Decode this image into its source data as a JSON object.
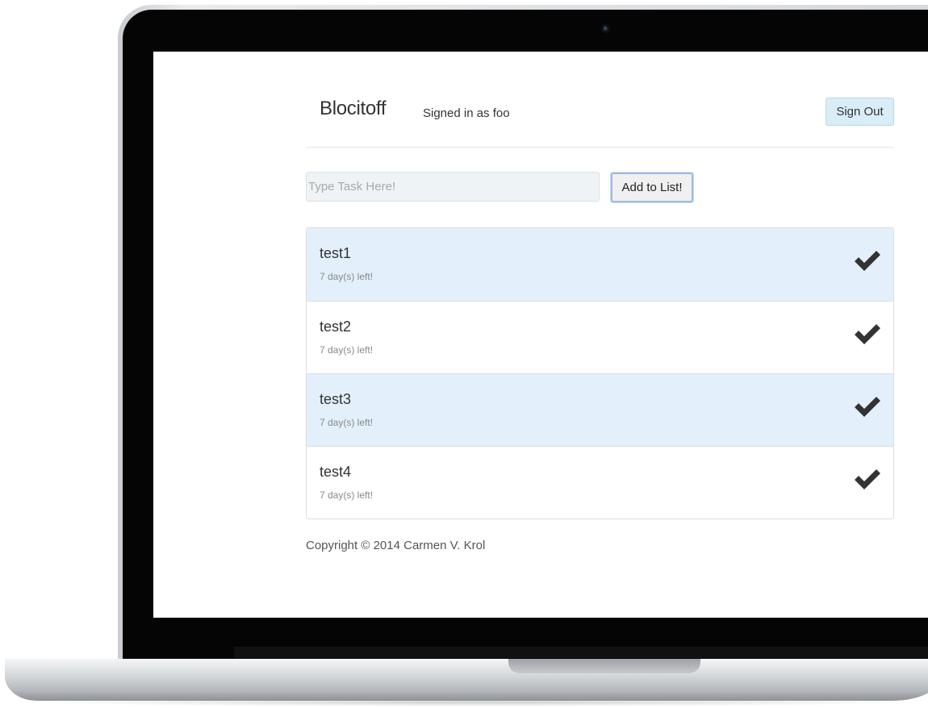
{
  "header": {
    "brand": "Blocitoff",
    "signed_in_text": "Signed in as foo",
    "sign_out_label": "Sign Out"
  },
  "task_form": {
    "placeholder": "Type Task Here!",
    "value": "",
    "add_label": "Add to List!"
  },
  "tasks": [
    {
      "name": "test1",
      "due": "7 day(s) left!",
      "icon": "checkmark-icon"
    },
    {
      "name": "test2",
      "due": "7 day(s) left!",
      "icon": "checkmark-icon"
    },
    {
      "name": "test3",
      "due": "7 day(s) left!",
      "icon": "checkmark-icon"
    },
    {
      "name": "test4",
      "due": "7 day(s) left!",
      "icon": "checkmark-icon"
    }
  ],
  "footer": {
    "copyright": "Copyright © 2014 Carmen V. Krol"
  },
  "colors": {
    "striped_row": "#e3f0fc",
    "sign_out_bg": "#d9edf7",
    "check_icon": "#333333"
  }
}
